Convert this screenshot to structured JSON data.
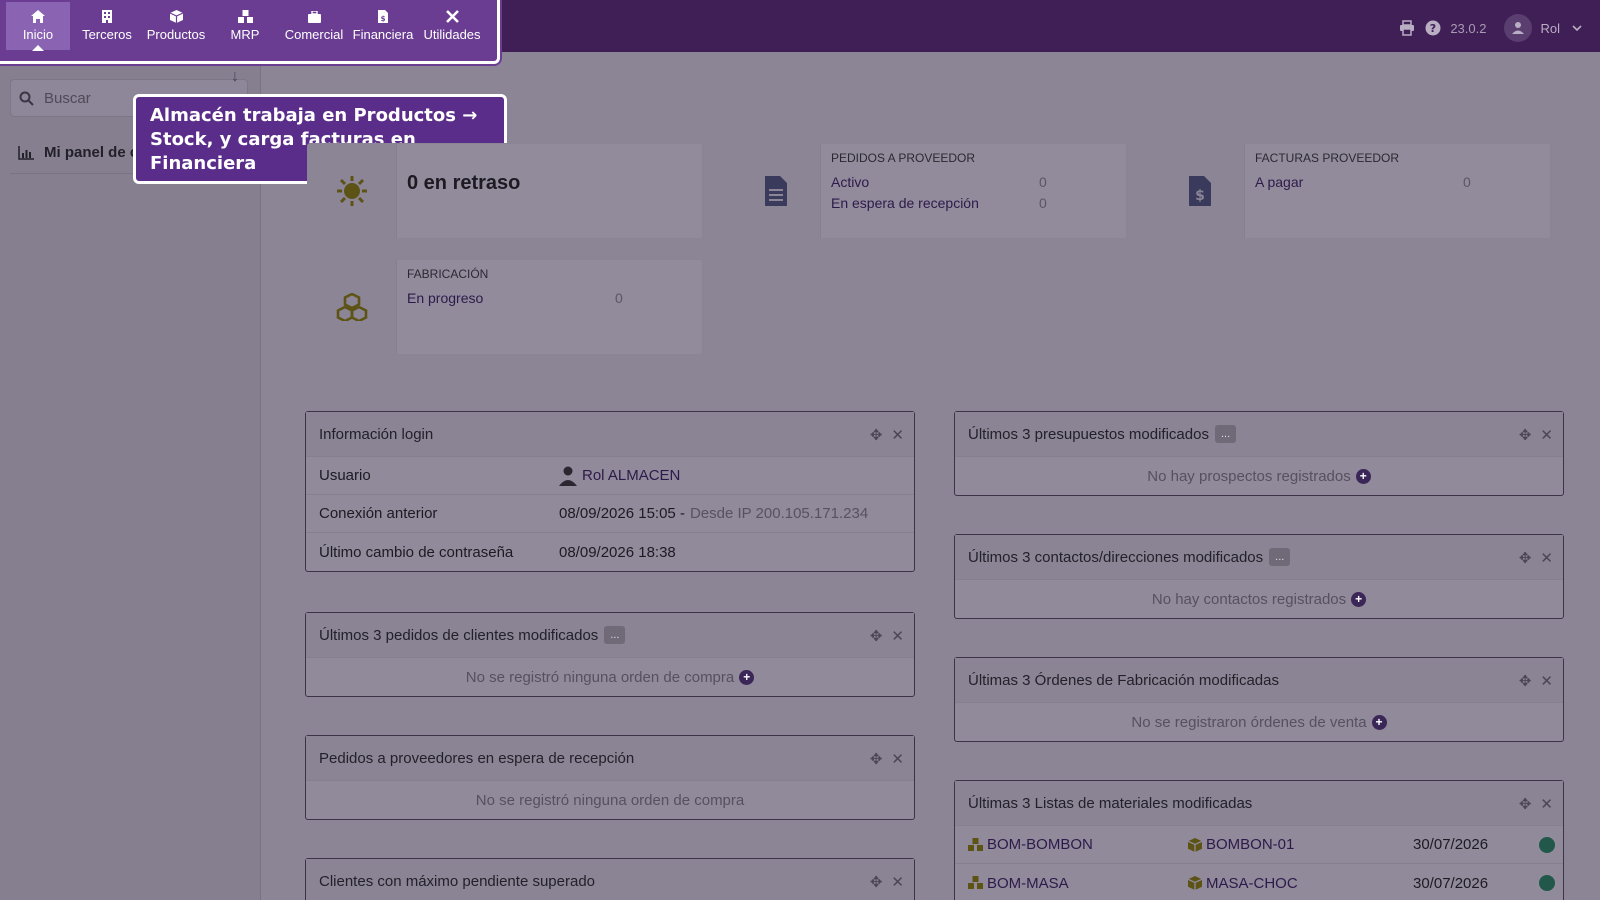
{
  "topbar": {
    "version": "23.0.2",
    "user_label": "Rol"
  },
  "menu": {
    "items": [
      {
        "label": "Inicio",
        "icon": "home-icon",
        "active": true
      },
      {
        "label": "Terceros",
        "icon": "building-icon"
      },
      {
        "label": "Productos",
        "icon": "cube-icon"
      },
      {
        "label": "MRP",
        "icon": "cubes-icon"
      },
      {
        "label": "Comercial",
        "icon": "suitcase-icon"
      },
      {
        "label": "Financiera",
        "icon": "invoice-icon"
      },
      {
        "label": "Utilidades",
        "icon": "tools-icon"
      }
    ]
  },
  "sidebar": {
    "search_placeholder": "Buscar",
    "dashboard_label": "Mi panel de c"
  },
  "tooltip": {
    "text": "Almacén trabaja en Productos → Stock, y carga facturas en Financiera"
  },
  "stats": {
    "delayed": {
      "value_text": "0 en retraso"
    },
    "supplier_orders": {
      "title": "PEDIDOS A PROVEEDOR",
      "rows": [
        {
          "label": "Activo",
          "value": "0"
        },
        {
          "label": "En espera de recepción",
          "value": "0"
        }
      ]
    },
    "supplier_invoices": {
      "title": "FACTURAS PROVEEDOR",
      "rows": [
        {
          "label": "A pagar",
          "value": "0"
        }
      ]
    },
    "manufacturing": {
      "title": "FABRICACIÓN",
      "rows": [
        {
          "label": "En progreso",
          "value": "0"
        }
      ]
    }
  },
  "widgets": {
    "login_info": {
      "title": "Información login",
      "user_key": "Usuario",
      "user_value": "Rol ALMACEN",
      "prev_conn_key": "Conexión anterior",
      "prev_conn_value": "08/09/2026 15:05 -",
      "prev_conn_ip": "Desde IP 200.105.171.234",
      "pwd_change_key": "Último cambio de contraseña",
      "pwd_change_value": "08/09/2026 18:38"
    },
    "customer_orders": {
      "title": "Últimos 3 pedidos de clientes modificados",
      "more": "...",
      "empty": "No se registró ninguna orden de compra"
    },
    "supplier_pending": {
      "title": "Pedidos a proveedores en espera de recepción",
      "empty": "No se registró ninguna orden de compra"
    },
    "clients_max": {
      "title": "Clientes con máximo pendiente superado"
    },
    "proposals": {
      "title": "Últimos 3 presupuestos modificados",
      "more": "...",
      "empty": "No hay prospectos registrados"
    },
    "contacts": {
      "title": "Últimos 3 contactos/direcciones modificados",
      "more": "...",
      "empty": "No hay contactos registrados"
    },
    "mo": {
      "title": "Últimas 3 Órdenes de Fabricación modificadas",
      "empty": "No se registraron órdenes de venta"
    },
    "boms": {
      "title": "Últimas 3 Listas de materiales modificadas",
      "rows": [
        {
          "ref": "BOM-BOMBON",
          "product": "BOMBON-01",
          "date": "30/07/2026"
        },
        {
          "ref": "BOM-MASA",
          "product": "MASA-CHOC",
          "date": "30/07/2026"
        }
      ]
    }
  },
  "colors": {
    "menu_bg": "#6a3d93",
    "tooltip_bg": "#5b2d8a",
    "topbar_bg": "#3f1f56",
    "status_enabled": "#22584a"
  }
}
